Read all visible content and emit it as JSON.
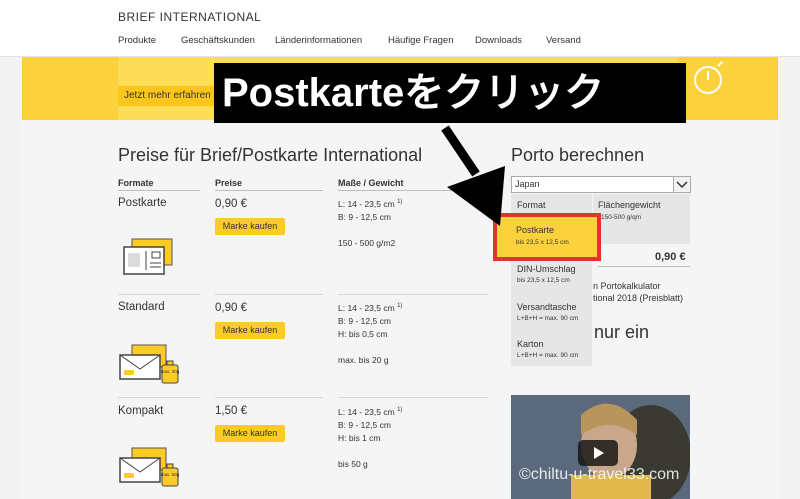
{
  "header": {
    "brand": "BRIEF INTERNATIONAL",
    "nav": [
      "Produkte",
      "Geschäftskunden",
      "Länderinformationen",
      "Häufige Fragen",
      "Downloads",
      "Versand"
    ]
  },
  "banner": {
    "cta_label": "Jetzt mehr erfahren"
  },
  "annotation": {
    "text": "Postkarteをクリック"
  },
  "prices": {
    "title": "Preise für Brief/Postkarte International",
    "columns": [
      "Formate",
      "Preise",
      "Maße / Gewicht"
    ],
    "buy_label": "Marke kaufen",
    "rows": [
      {
        "name": "Postkarte",
        "price": "0,90 €",
        "dims": [
          "L: 14 - 23,5 cm",
          "B: 9 - 12,5 cm",
          "",
          "150 - 500 g/m2"
        ]
      },
      {
        "name": "Standard",
        "price": "0,90 €",
        "dims": [
          "L: 14 - 23,5 cm",
          "B: 9 - 12,5 cm",
          "H: bis 0,5 cm",
          "",
          "max. bis 20 g"
        ]
      },
      {
        "name": "Kompakt",
        "price": "1,50 €",
        "dims": [
          "L: 14 - 23,5 cm",
          "B: 9 - 12,5 cm",
          "H: bis 1 cm",
          "",
          "bis 50 g"
        ]
      }
    ],
    "footnote_mark": "1)",
    "weight_badges": [
      "max. 20g",
      "max. 50g"
    ]
  },
  "porto": {
    "title": "Porto berechnen",
    "country": "Japan",
    "dropdown": [
      {
        "label": "Format",
        "sub": ""
      },
      {
        "label": "Postkarte",
        "sub": "bis 23,5 x 12,5 cm"
      },
      {
        "label": "DIN-Umschlag",
        "sub": "bis 23,5 x 12,5 cm"
      },
      {
        "label": "Versandtasche",
        "sub": "L+B+H = max. 90 cm"
      },
      {
        "label": "Karton",
        "sub": "L+B+H = max. 90 cm"
      }
    ],
    "flaechengewicht_label": "Flächengewicht",
    "flaechengewicht_value": "150-500 g/qm",
    "total": "0,90 €",
    "info_line1": "n Portokalkulator",
    "info_line2": "tional 2018 (Preisblatt)",
    "nur_ein": "nur ein"
  },
  "video": {
    "watermark": "©chiltu-u-travel33.com"
  },
  "colors": {
    "yellow": "#fcd23c",
    "highlight_red": "#e5322d"
  }
}
